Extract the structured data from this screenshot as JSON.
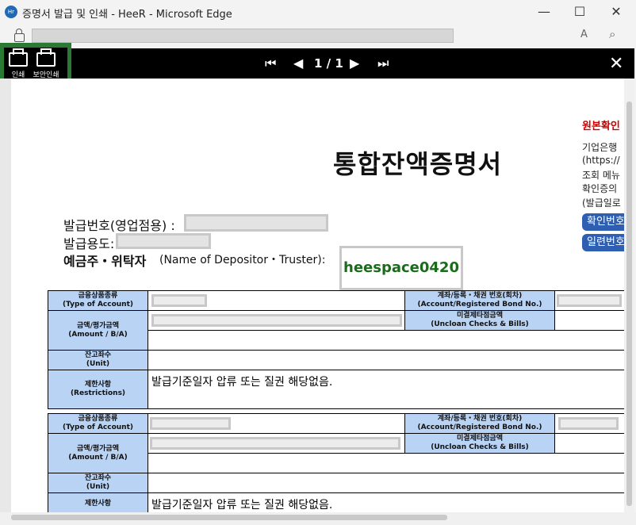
{
  "window": {
    "title": "증명서 발급 및 인쇄 - HeeR - Microsoft Edge",
    "app_icon": "heer-app-icon",
    "minimize": "—",
    "maximize": "☐",
    "close": "✕"
  },
  "address_bar": {
    "lock_icon": "lock-icon",
    "read_aloud": "A",
    "zoom_icon": "⌕"
  },
  "toolbar": {
    "print_label": "인쇄",
    "secure_print_label": "보안인쇄",
    "first_page": "⏮",
    "prev_page": "◀",
    "page_indicator": "1 / 1",
    "next_page": "▶",
    "last_page": "⏭",
    "close": "✕"
  },
  "document": {
    "title": "통합잔액증명서",
    "issue_number_label": "발급번호(영업점용) :",
    "purpose_label": "발급용도:",
    "depositor_label_bold": "예금주・위탁자",
    "depositor_label_en": "(Name of Depositor・Truster):",
    "depositor_name": "heespace0420",
    "side": {
      "original_check": "원본확인",
      "lines": [
        "기업은행",
        "(https://",
        "조회 메뉴",
        "확인증의",
        "(발급일로"
      ],
      "confirm_button": "확인번호",
      "serial_button": "일련번호"
    },
    "tables": [
      {
        "account_type_label": "금융상품종류",
        "account_type_label_en": "(Type of Account)",
        "bond_no_label": "계좌/등록・채권 번호(회차)",
        "bond_no_label_en": "(Account/Registered Bond No.)",
        "amount_label": "금액/평가금액",
        "amount_label_en": "(Amount / B/A)",
        "unclear_label": "미결제타점금액",
        "unclear_label_en": "(Uncloan Checks & Bills)",
        "units_label": "잔고좌수",
        "units_label_en": "(Unit)",
        "restrictions_label": "제한사항",
        "restrictions_label_en": "(Restrictions)",
        "restrictions_value": "발급기준일자 압류 또는 질권 해당없음."
      },
      {
        "account_type_label": "금융상품종류",
        "account_type_label_en": "(Type of Account)",
        "bond_no_label": "계좌/등록・채권 번호(회차)",
        "bond_no_label_en": "(Account/Registered Bond No.)",
        "amount_label": "금액/평가금액",
        "amount_label_en": "(Amount / B/A)",
        "unclear_label": "미결제타점금액",
        "unclear_label_en": "(Uncloan Checks & Bills)",
        "units_label": "잔고좌수",
        "units_label_en": "(Unit)",
        "restrictions_label": "제한사항",
        "restrictions_value": "발급기준일자 압류 또는 질권 해당없음."
      }
    ]
  }
}
